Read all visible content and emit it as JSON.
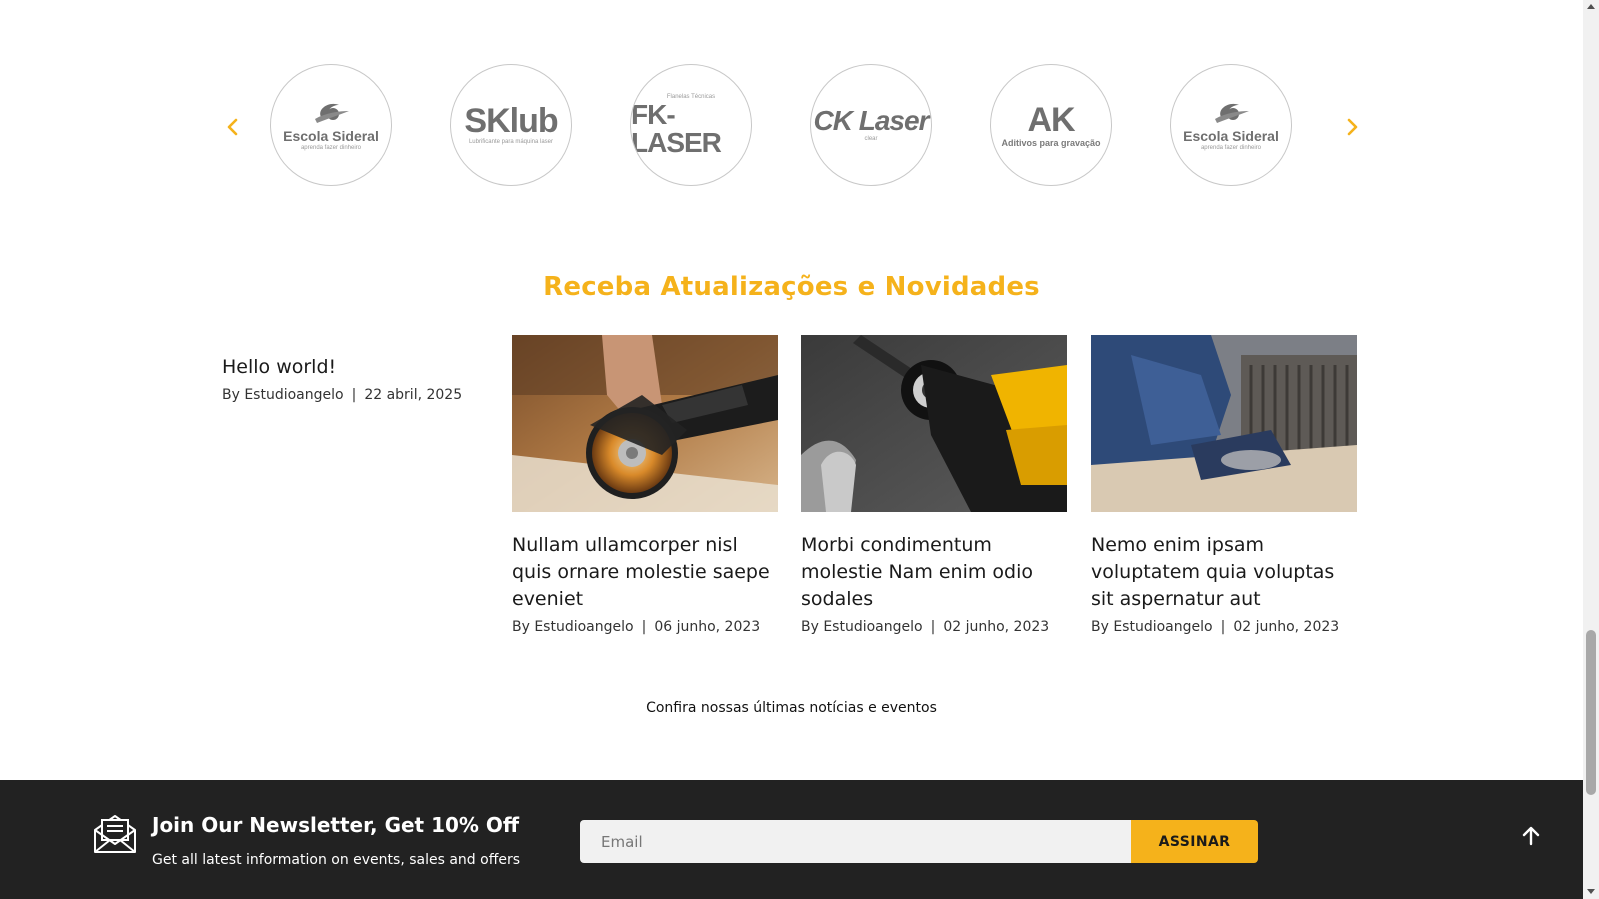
{
  "brands": {
    "items": [
      {
        "name": "Escola Sideral",
        "sub": "aprenda fazer dinheiro",
        "icon": "escola-sideral-logo"
      },
      {
        "name": "SKlub",
        "sub": "Lubrificante para máquina laser",
        "icon": "sklub-logo"
      },
      {
        "name": "FK-LASER",
        "sub": "Flanelas Técnicas",
        "icon": "fk-laser-logo"
      },
      {
        "name": "CK Laser",
        "sub": "clear",
        "icon": "ck-laser-logo"
      },
      {
        "name": "AK",
        "sub": "Aditivos para gravação",
        "icon": "ak-logo"
      },
      {
        "name": "Escola Sideral",
        "sub": "aprenda fazer dinheiro",
        "icon": "escola-sideral-logo"
      }
    ],
    "prev_icon": "chevron-left-icon",
    "next_icon": "chevron-right-icon",
    "accent": "#f5b21b"
  },
  "news": {
    "title": "Receba Atualizações e Novidades",
    "posts": [
      {
        "title": "Hello world!",
        "author": "By Estudioangelo",
        "separator": "|",
        "date": "22 abril, 2025"
      },
      {
        "title": "Nullam ullamcorper nisl quis ornare molestie saepe eveniet",
        "author": "By Estudioangelo",
        "separator": "|",
        "date": "06 junho, 2023",
        "image": "angle-grinder-photo"
      },
      {
        "title": "Morbi condimentum molestie Nam enim odio sodales",
        "author": "By Estudioangelo",
        "separator": "|",
        "date": "02 junho, 2023",
        "image": "drill-photo"
      },
      {
        "title": "Nemo enim ipsam voluptatem quia voluptas sit aspernatur aut",
        "author": "By Estudioangelo",
        "separator": "|",
        "date": "02 junho, 2023",
        "image": "worker-sander-photo"
      }
    ],
    "link_text": "Confira nossas últimas notícias e eventos"
  },
  "newsletter": {
    "title": "Join Our Newsletter, Get 10% Off",
    "subtitle": "Get all latest information on events, sales and offers",
    "email_placeholder": "Email",
    "button_label": "ASSINAR",
    "icon": "envelope-icon",
    "back_to_top_icon": "arrow-up-icon",
    "bg_color": "#222222",
    "button_color": "#f5b21b"
  }
}
